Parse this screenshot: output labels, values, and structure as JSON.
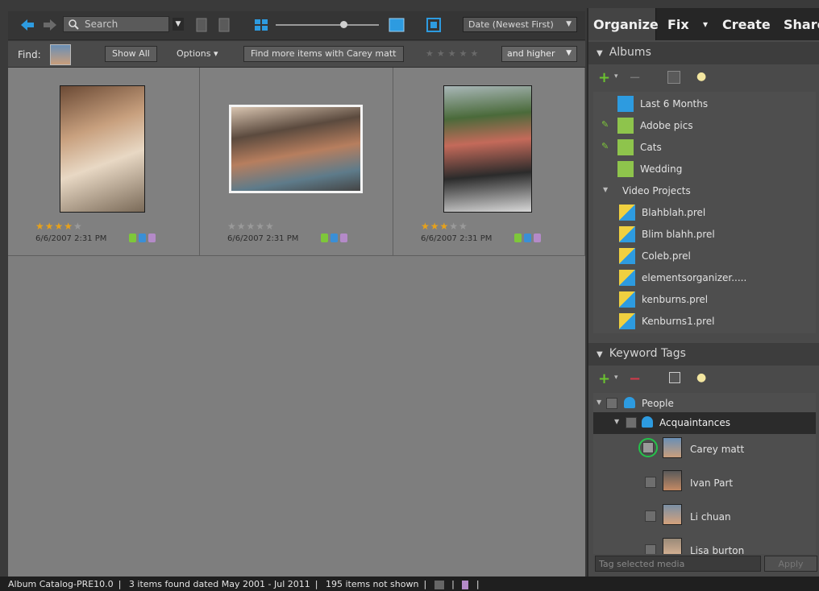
{
  "toolbar": {
    "search_label": "Search",
    "sort_value": "Date (Newest First)"
  },
  "findbar": {
    "find_label": "Find:",
    "show_all": "Show All",
    "options": "Options",
    "find_more": "Find more items with Carey matt",
    "rating_filter": "and higher"
  },
  "media": [
    {
      "rating": 4,
      "date": "6/6/2007 2:31 PM"
    },
    {
      "rating": 0,
      "date": "6/6/2007 2:31 PM"
    },
    {
      "rating": 3,
      "date": "6/6/2007 2:31 PM"
    }
  ],
  "tabs": {
    "organize": "Organize",
    "fix": "Fix",
    "create": "Create",
    "share": "Share"
  },
  "albums": {
    "title": "Albums",
    "items": [
      {
        "label": "Last 6 Months"
      },
      {
        "label": "Adobe pics"
      },
      {
        "label": "Cats"
      },
      {
        "label": "Wedding"
      },
      {
        "label": "Video Projects"
      },
      {
        "label": "Blahblah.prel"
      },
      {
        "label": "Blim blahh.prel"
      },
      {
        "label": "Coleb.prel"
      },
      {
        "label": "elementsorganizer....."
      },
      {
        "label": "kenburns.prel"
      },
      {
        "label": "Kenburns1.prel"
      }
    ]
  },
  "keywords": {
    "title": "Keyword Tags",
    "people": "People",
    "acquaintances": "Acquaintances",
    "persons": [
      {
        "label": "Carey matt"
      },
      {
        "label": "Ivan Part"
      },
      {
        "label": "Li chuan"
      },
      {
        "label": "Lisa burton"
      }
    ],
    "tag_placeholder": "Tag selected media",
    "apply": "Apply"
  },
  "status": {
    "catalog": "Album Catalog-PRE10.0",
    "found": "3 items found dated May 2001 - Jul 2011",
    "not_shown": "195 items not shown"
  },
  "colors": {
    "accent_blue": "#1e8fd6",
    "star": "#e8a21a",
    "tag_green": "#7ec73a",
    "selection_circle": "#24c24a"
  }
}
